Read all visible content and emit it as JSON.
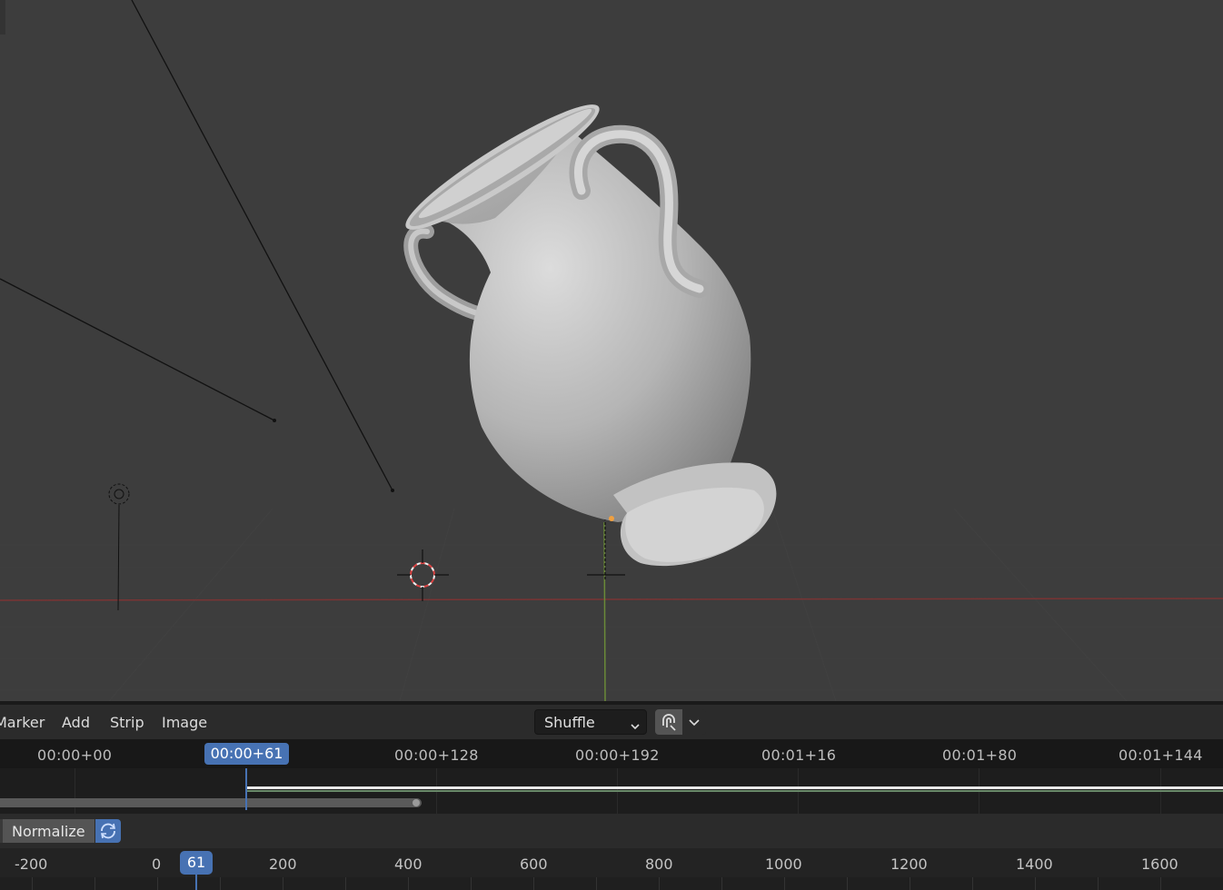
{
  "viewport": {
    "object_icon": "vase-mesh",
    "cursor_icon": "3d-cursor-icon",
    "origin_icon": "object-origin-icon"
  },
  "sequencer": {
    "menus": [
      "Marker",
      "Add",
      "Strip",
      "Image"
    ],
    "overlap_mode": "Shuffle",
    "snap_icon": "magnet-icon",
    "timecodes": [
      "00:00+00",
      "00:00+128",
      "00:00+192",
      "00:01+16",
      "00:01+80",
      "00:01+144"
    ],
    "current_timecode": "00:00+61"
  },
  "graph": {
    "normalize_label": "Normalize",
    "refresh_icon": "refresh-icon",
    "frames": [
      "-200",
      "0",
      "200",
      "400",
      "600",
      "800",
      "1000",
      "1200",
      "1400",
      "1600"
    ],
    "current_frame": "61"
  },
  "colors": {
    "accent": "#4772b3",
    "x_axis": "#8c3a3a",
    "z_axis": "#6e8a3a",
    "background": "#3d3d3d"
  }
}
